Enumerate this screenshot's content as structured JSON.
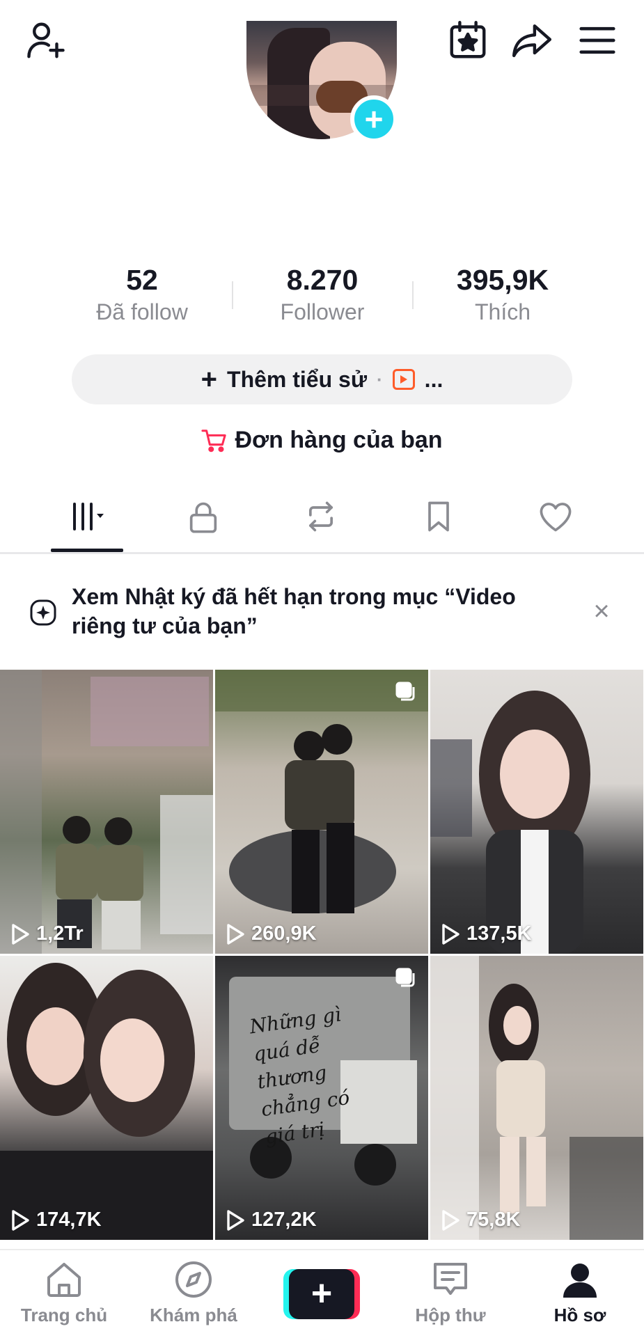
{
  "profile": {
    "avatar_add_label": "+"
  },
  "stats": [
    {
      "value": "52",
      "label": "Đã follow"
    },
    {
      "value": "8.270",
      "label": "Follower"
    },
    {
      "value": "395,9K",
      "label": "Thích"
    }
  ],
  "bio_button": {
    "plus": "+",
    "label": "Thêm tiểu sử",
    "dot": "·",
    "more": "..."
  },
  "orders": {
    "label": "Đơn hàng của bạn"
  },
  "notice": {
    "text": "Xem Nhật ký đã hết hạn trong mục “Video riêng tư của bạn”",
    "close": "×"
  },
  "videos": [
    {
      "views": "1,2Tr"
    },
    {
      "views": "260,9K"
    },
    {
      "views": "137,5K"
    },
    {
      "views": "174,7K"
    },
    {
      "views": "127,2K",
      "caption": "Những gì quá dễ thương chẳng có giá trị"
    },
    {
      "views": "75,8K"
    }
  ],
  "bottom_nav": [
    {
      "label": "Trang chủ",
      "icon": "home-icon"
    },
    {
      "label": "Khám phá",
      "icon": "compass-icon"
    },
    {
      "label": "",
      "icon": "create-icon"
    },
    {
      "label": "Hộp thư",
      "icon": "inbox-icon"
    },
    {
      "label": "Hồ sơ",
      "icon": "profile-icon",
      "active": true
    }
  ],
  "colors": {
    "accent_cyan": "#20d5ec",
    "brand_red": "#fe2c55",
    "brand_cyan": "#25f4ee",
    "text_primary": "#161823",
    "text_secondary": "#8a8b91"
  }
}
